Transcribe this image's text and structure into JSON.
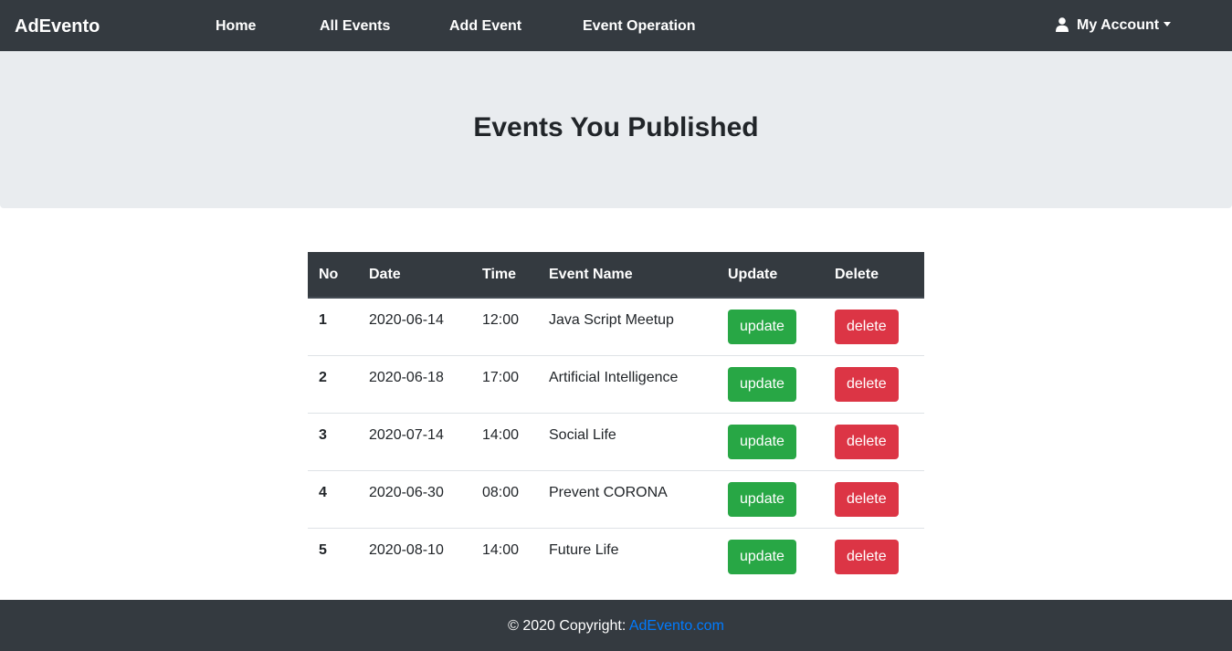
{
  "navbar": {
    "brand": "AdEvento",
    "links": [
      "Home",
      "All Events",
      "Add Event",
      "Event Operation"
    ],
    "account_label": "My Account"
  },
  "hero": {
    "title": "Events You Published"
  },
  "table": {
    "headers": [
      "No",
      "Date",
      "Time",
      "Event Name",
      "Update",
      "Delete"
    ],
    "rows": [
      {
        "no": "1",
        "date": "2020-06-14",
        "time": "12:00",
        "name": "Java Script Meetup",
        "update": "update",
        "delete": "delete"
      },
      {
        "no": "2",
        "date": "2020-06-18",
        "time": "17:00",
        "name": "Artificial Intelligence",
        "update": "update",
        "delete": "delete"
      },
      {
        "no": "3",
        "date": "2020-07-14",
        "time": "14:00",
        "name": "Social Life",
        "update": "update",
        "delete": "delete"
      },
      {
        "no": "4",
        "date": "2020-06-30",
        "time": "08:00",
        "name": "Prevent CORONA",
        "update": "update",
        "delete": "delete"
      },
      {
        "no": "5",
        "date": "2020-08-10",
        "time": "14:00",
        "name": "Future Life",
        "update": "update",
        "delete": "delete"
      }
    ]
  },
  "footer": {
    "copyright": "© 2020 Copyright:",
    "link": "AdEvento.com"
  },
  "colors": {
    "navbar_bg": "#343a40",
    "hero_bg": "#e9ecef",
    "update_button": "#28a745",
    "delete_button": "#dc3545",
    "footer_link": "#007bff"
  },
  "icons": {
    "account": "user-icon",
    "account_dropdown": "caret-down-icon"
  }
}
